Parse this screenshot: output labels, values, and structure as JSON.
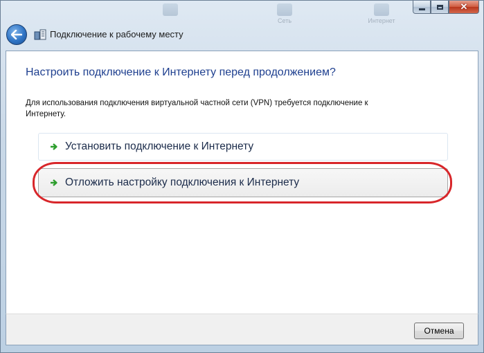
{
  "window": {
    "title": "Подключение к рабочему месту",
    "background_ghost_labels": [
      "Сеть",
      "Интернет"
    ]
  },
  "content": {
    "heading": "Настроить подключение к Интернету перед продолжением?",
    "description": "Для использования подключения виртуальной частной сети (VPN) требуется подключение к Интернету.",
    "options": [
      {
        "label": "Установить подключение к Интернету",
        "icon": "green-arrow-icon"
      },
      {
        "label": "Отложить настройку подключения к Интернету",
        "icon": "green-arrow-icon",
        "highlighted": true
      }
    ]
  },
  "footer": {
    "cancel_label": "Отмена"
  },
  "colors": {
    "heading": "#1e3f8f",
    "highlight_outline": "#d8262a",
    "arrow_green": "#2e9e2e",
    "close_button": "#c9452a"
  }
}
